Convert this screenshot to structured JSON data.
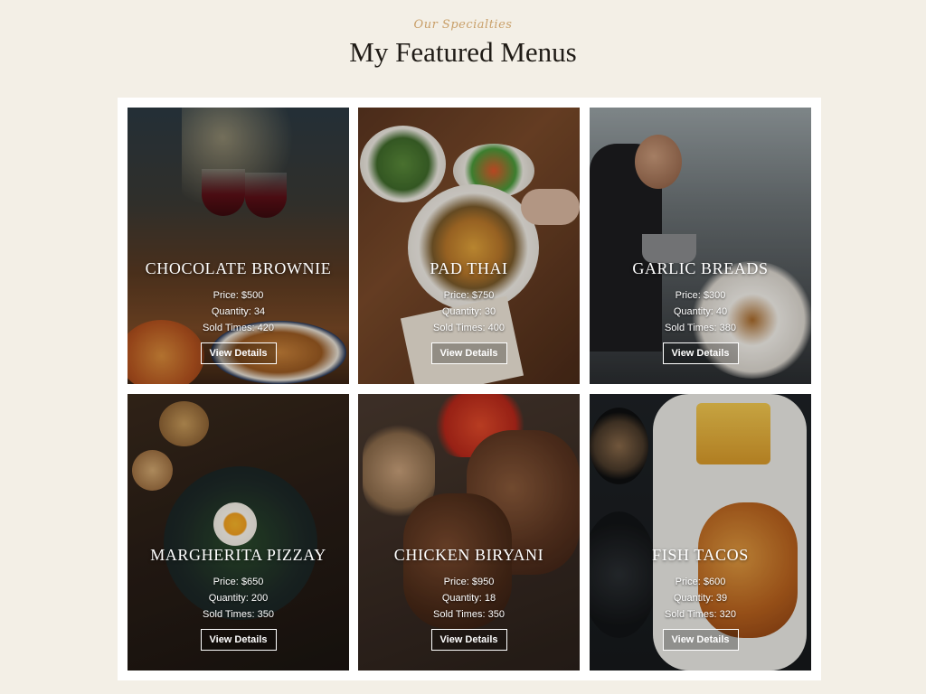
{
  "header": {
    "eyebrow": "Our Specialties",
    "title": "My Featured Menus"
  },
  "labels": {
    "price": "Price:",
    "quantity": "Quantity:",
    "sold": "Sold Times:"
  },
  "menus": [
    {
      "name": "CHOCOLATE BROWNIE",
      "price": "$500",
      "quantity": "34",
      "sold": "420",
      "button": "View Details"
    },
    {
      "name": "PAD THAI",
      "price": "$750",
      "quantity": "30",
      "sold": "400",
      "button": "View Details"
    },
    {
      "name": "GARLIC BREADS",
      "price": "$300",
      "quantity": "40",
      "sold": "380",
      "button": "View Details"
    },
    {
      "name": "MARGHERITA PIZZAY",
      "price": "$650",
      "quantity": "200",
      "sold": "350",
      "button": "View Details"
    },
    {
      "name": "CHICKEN BIRYANI",
      "price": "$950",
      "quantity": "18",
      "sold": "350",
      "button": "View Details"
    },
    {
      "name": "FISH TACOS",
      "price": "$600",
      "quantity": "39",
      "sold": "320",
      "button": "View Details"
    }
  ]
}
